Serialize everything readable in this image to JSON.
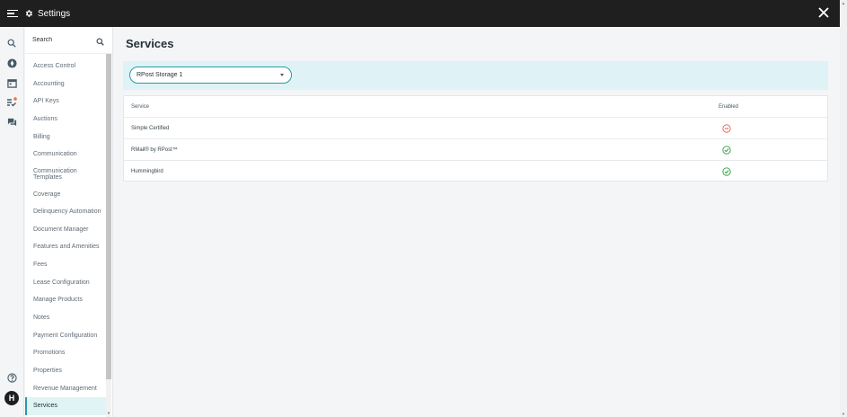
{
  "topbar": {
    "title": "Settings",
    "menu_icon": "hamburger-menu-icon",
    "settings_icon": "gear-icon",
    "close_icon": "close-icon"
  },
  "rail": {
    "icons": [
      "search-icon",
      "compass-icon",
      "calendar-icon",
      "task-list-icon",
      "chat-icon",
      "help-icon"
    ],
    "avatar_initial": "H",
    "notification_color": "#f26d3d"
  },
  "sidebar": {
    "search_placeholder": "Search",
    "items": [
      {
        "label": "Access Control"
      },
      {
        "label": "Accounting"
      },
      {
        "label": "API Keys"
      },
      {
        "label": "Auctions"
      },
      {
        "label": "Billing"
      },
      {
        "label": "Communication"
      },
      {
        "label": "Communication Templates"
      },
      {
        "label": "Coverage"
      },
      {
        "label": "Delinquency Automation"
      },
      {
        "label": "Document Manager"
      },
      {
        "label": "Features and Amenities"
      },
      {
        "label": "Fees"
      },
      {
        "label": "Lease Configuration"
      },
      {
        "label": "Manage Products"
      },
      {
        "label": "Notes"
      },
      {
        "label": "Payment Configuration"
      },
      {
        "label": "Promotions"
      },
      {
        "label": "Properties"
      },
      {
        "label": "Revenue Management"
      },
      {
        "label": "Services"
      }
    ],
    "active_item": "Services"
  },
  "main": {
    "title": "Services",
    "facility_select": {
      "value": "RPost Storage 1"
    },
    "table": {
      "headers": {
        "service": "Service",
        "enabled": "Enabled"
      },
      "rows": [
        {
          "service": "Simple Certified",
          "enabled": false
        },
        {
          "service": "RMail® by RPost™",
          "enabled": true
        },
        {
          "service": "Hummingbird",
          "enabled": true
        }
      ]
    }
  },
  "colors": {
    "accent": "#2a9aa8",
    "enabled": "#2e9e3e",
    "disabled": "#e5534b",
    "topbar": "#1f1f1f",
    "filter_bg": "#dff2f5"
  }
}
